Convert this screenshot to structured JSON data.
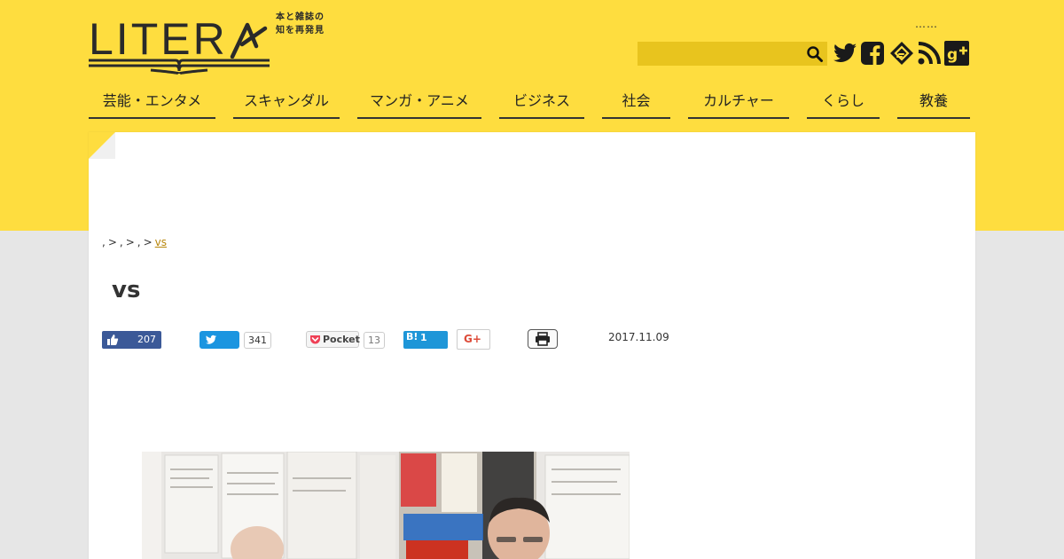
{
  "header": {
    "logo_text": "LITER",
    "logo_tagline_1": "本と雑誌の",
    "logo_tagline_2": "知を再発見",
    "ellipsis": "……",
    "search": {
      "value": "",
      "placeholder": ""
    }
  },
  "social_icons": [
    "twitter-icon",
    "facebook-icon",
    "feedly-icon",
    "rss-icon",
    "googleplus-icon"
  ],
  "nav": [
    {
      "label": "芸能・エンタメ"
    },
    {
      "label": "スキャンダル"
    },
    {
      "label": "マンガ・アニメ"
    },
    {
      "label": "ビジネス"
    },
    {
      "label": "社会"
    },
    {
      "label": "カルチャー"
    },
    {
      "label": "くらし"
    },
    {
      "label": "教養"
    }
  ],
  "breadcrumb": {
    "crumbs": [
      ",",
      ",",
      ","
    ],
    "separator": ">",
    "current": "vs"
  },
  "article": {
    "title": "vs",
    "date": "2017.11.09"
  },
  "share": {
    "fb_count": "207",
    "tw_count": "341",
    "pocket_label": "Pocket",
    "pocket_count": "13",
    "hatena_label": "B!",
    "hatena_count": "1",
    "gplus_label": "G+"
  },
  "colors": {
    "brand_yellow": "#fedd3f",
    "search_bg": "#e8c41e",
    "facebook": "#3b5998",
    "twitter": "#1b95e0",
    "hatena": "#1e96d8",
    "gplus": "#dd4b39",
    "pocket": "#ef4056"
  }
}
